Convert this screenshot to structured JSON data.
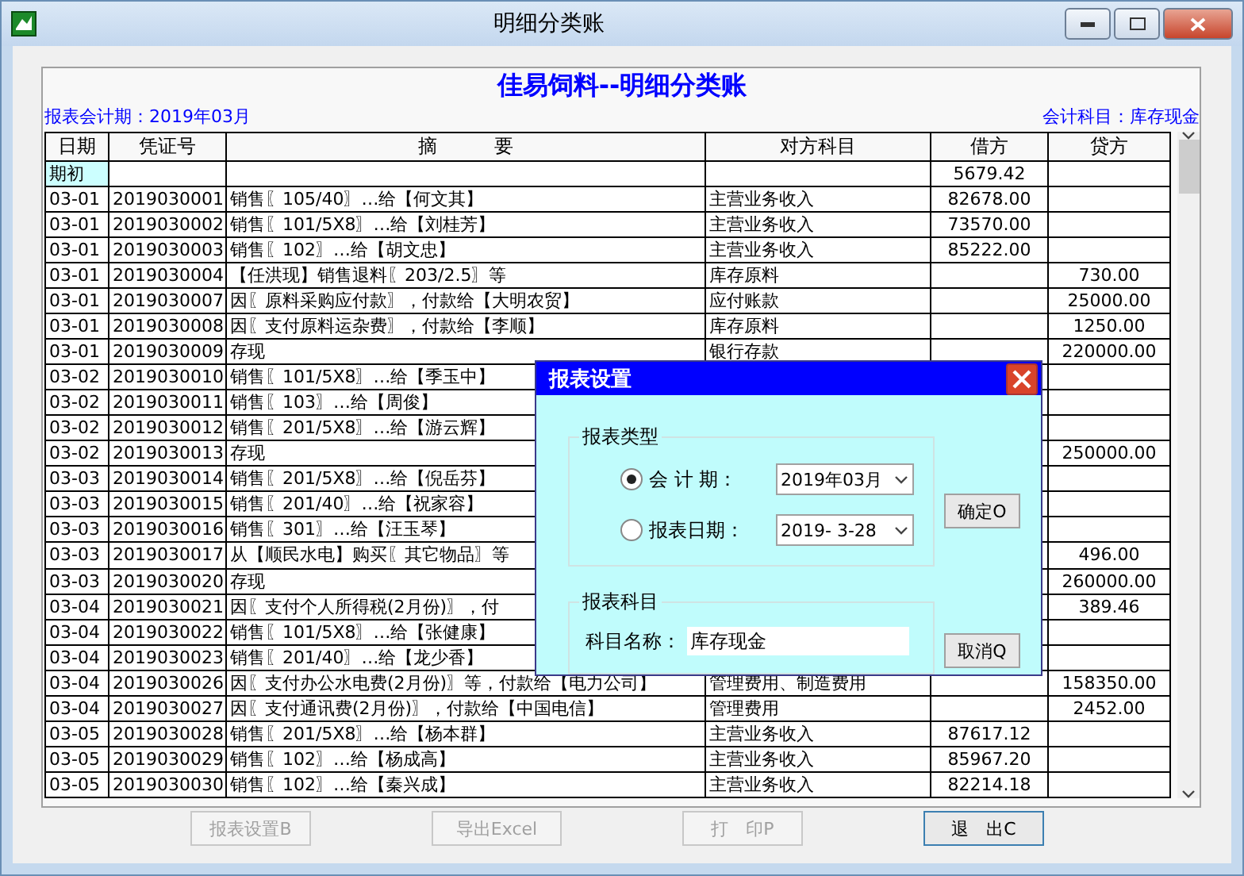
{
  "window": {
    "title": "明细分类账"
  },
  "report": {
    "heading": "佳易饲料--明细分类账",
    "period": "报表会计期：2019年03月",
    "account": "会计科目：库存现金"
  },
  "table": {
    "columns": [
      "日期",
      "凭证号",
      "摘　　　要",
      "对方科目",
      "借方",
      "贷方"
    ],
    "rows": [
      {
        "date": "期初",
        "debit": "5679.42",
        "highlight": true
      },
      {
        "date": "03-01",
        "voucher": "2019030001",
        "summary": "销售〖105/40〗…给【何文其】",
        "counter": "主营业务收入",
        "debit": "82678.00"
      },
      {
        "date": "03-01",
        "voucher": "2019030002",
        "summary": "销售〖101/5X8〗…给【刘桂芳】",
        "counter": "主营业务收入",
        "debit": "73570.00"
      },
      {
        "date": "03-01",
        "voucher": "2019030003",
        "summary": "销售〖102〗…给【胡文忠】",
        "counter": "主营业务收入",
        "debit": "85222.00"
      },
      {
        "date": "03-01",
        "voucher": "2019030004",
        "summary": "【任洪现】销售退料〖203/2.5〗等",
        "counter": "库存原料",
        "credit": "730.00"
      },
      {
        "date": "03-01",
        "voucher": "2019030007",
        "summary": "因〖原料采购应付款〗，付款给【大明农贸】",
        "counter": "应付账款",
        "credit": "25000.00"
      },
      {
        "date": "03-01",
        "voucher": "2019030008",
        "summary": "因〖支付原料运杂费〗，付款给【李顺】",
        "counter": "库存原料",
        "credit": "1250.00"
      },
      {
        "date": "03-01",
        "voucher": "2019030009",
        "summary": "存现",
        "counter": "银行存款",
        "credit": "220000.00"
      },
      {
        "date": "03-02",
        "voucher": "2019030010",
        "summary": "销售〖101/5X8〗…给【季玉中】"
      },
      {
        "date": "03-02",
        "voucher": "2019030011",
        "summary": "销售〖103〗…给【周俊】"
      },
      {
        "date": "03-02",
        "voucher": "2019030012",
        "summary": "销售〖201/5X8〗…给【游云辉】"
      },
      {
        "date": "03-02",
        "voucher": "2019030013",
        "summary": "存现",
        "credit": "250000.00"
      },
      {
        "date": "03-03",
        "voucher": "2019030014",
        "summary": "销售〖201/5X8〗…给【倪岳芬】"
      },
      {
        "date": "03-03",
        "voucher": "2019030015",
        "summary": "销售〖201/40〗…给【祝家容】"
      },
      {
        "date": "03-03",
        "voucher": "2019030016",
        "summary": "销售〖301〗…给【汪玉琴】"
      },
      {
        "date": "03-03",
        "voucher": "2019030017",
        "summary": "从【顺民水电】购买〖其它物品〗等",
        "credit": "496.00"
      },
      {
        "date": "03-03",
        "voucher": "2019030020",
        "summary": "存现",
        "credit": "260000.00"
      },
      {
        "date": "03-04",
        "voucher": "2019030021",
        "summary": "因〖支付个人所得税(2月份)〗，付",
        "credit": "389.46"
      },
      {
        "date": "03-04",
        "voucher": "2019030022",
        "summary": "销售〖101/5X8〗…给【张健康】"
      },
      {
        "date": "03-04",
        "voucher": "2019030023",
        "summary": "销售〖201/40〗…给【龙少香】"
      },
      {
        "date": "03-04",
        "voucher": "2019030026",
        "summary": "因〖支付办公水电费(2月份)〗等，付款给【电力公司】",
        "counter": "管理费用、制造费用",
        "credit": "158350.00"
      },
      {
        "date": "03-04",
        "voucher": "2019030027",
        "summary": "因〖支付通讯费(2月份)〗，付款给【中国电信】",
        "counter": "管理费用",
        "credit": "2452.00"
      },
      {
        "date": "03-05",
        "voucher": "2019030028",
        "summary": "销售〖201/5X8〗…给【杨本群】",
        "counter": "主营业务收入",
        "debit": "87617.12"
      },
      {
        "date": "03-05",
        "voucher": "2019030029",
        "summary": "销售〖102〗…给【杨成高】",
        "counter": "主营业务收入",
        "debit": "85967.20"
      },
      {
        "date": "03-05",
        "voucher": "2019030030",
        "summary": "销售〖102〗…给【秦兴成】",
        "counter": "主营业务收入",
        "debit": "82214.18"
      }
    ]
  },
  "buttons": [
    {
      "label": "报表设置B",
      "disabled": true
    },
    {
      "label": "导出Excel",
      "disabled": true
    },
    {
      "label": "打　印P",
      "disabled": true
    },
    {
      "label": "退　出C",
      "disabled": false
    }
  ],
  "dialog": {
    "title": "报表设置",
    "type_group": "报表类型",
    "options": [
      {
        "label": "会 计 期：",
        "value": "2019年03月",
        "selected": true
      },
      {
        "label": "报表日期：",
        "value": "2019- 3-28",
        "selected": false
      }
    ],
    "subject_group": "报表科目",
    "subject_label": "科目名称：",
    "subject_value": "库存现金",
    "ok": "确定O",
    "cancel": "取消Q"
  }
}
